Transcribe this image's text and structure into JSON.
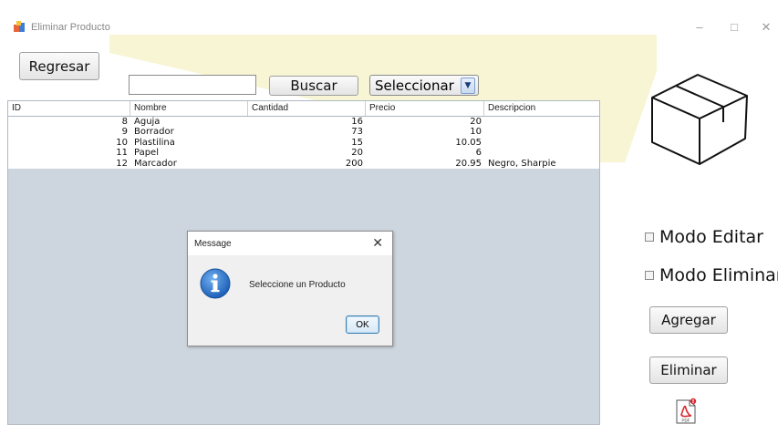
{
  "window": {
    "title": "Eliminar Producto"
  },
  "toolbar": {
    "back_label": "Regresar",
    "search_value": "",
    "search_label": "Buscar",
    "select_value": "Seleccionar"
  },
  "table": {
    "columns": [
      "ID",
      "Nombre",
      "Cantidad",
      "Precio",
      "Descripcion"
    ],
    "rows": [
      [
        "8",
        "Aguja",
        "16",
        "20",
        ""
      ],
      [
        "9",
        "Borrador",
        "73",
        "10",
        ""
      ],
      [
        "10",
        "Plastilina",
        "15",
        "10.05",
        ""
      ],
      [
        "11",
        "Papel",
        "20",
        "6",
        ""
      ],
      [
        "12",
        "Marcador",
        "200",
        "20.95",
        "Negro, Sharpie"
      ]
    ]
  },
  "dialog": {
    "title": "Message",
    "message": "Seleccione un Producto",
    "ok_label": "OK"
  },
  "side": {
    "edit_mode_label": "Modo Editar",
    "edit_mode_checked": false,
    "delete_mode_label": "Modo Eliminar",
    "delete_mode_checked": false,
    "add_label": "Agregar",
    "delete_label": "Eliminar"
  },
  "icons": {
    "app": "product-app-icon",
    "box": "box-icon",
    "info": "info-icon",
    "pdf": "pdf-icon"
  },
  "colors": {
    "table_background": "#cdd5de",
    "wedge": "#f7f5d4",
    "info_blue": "#2a6fc9",
    "pdf_red": "#d8262f"
  }
}
